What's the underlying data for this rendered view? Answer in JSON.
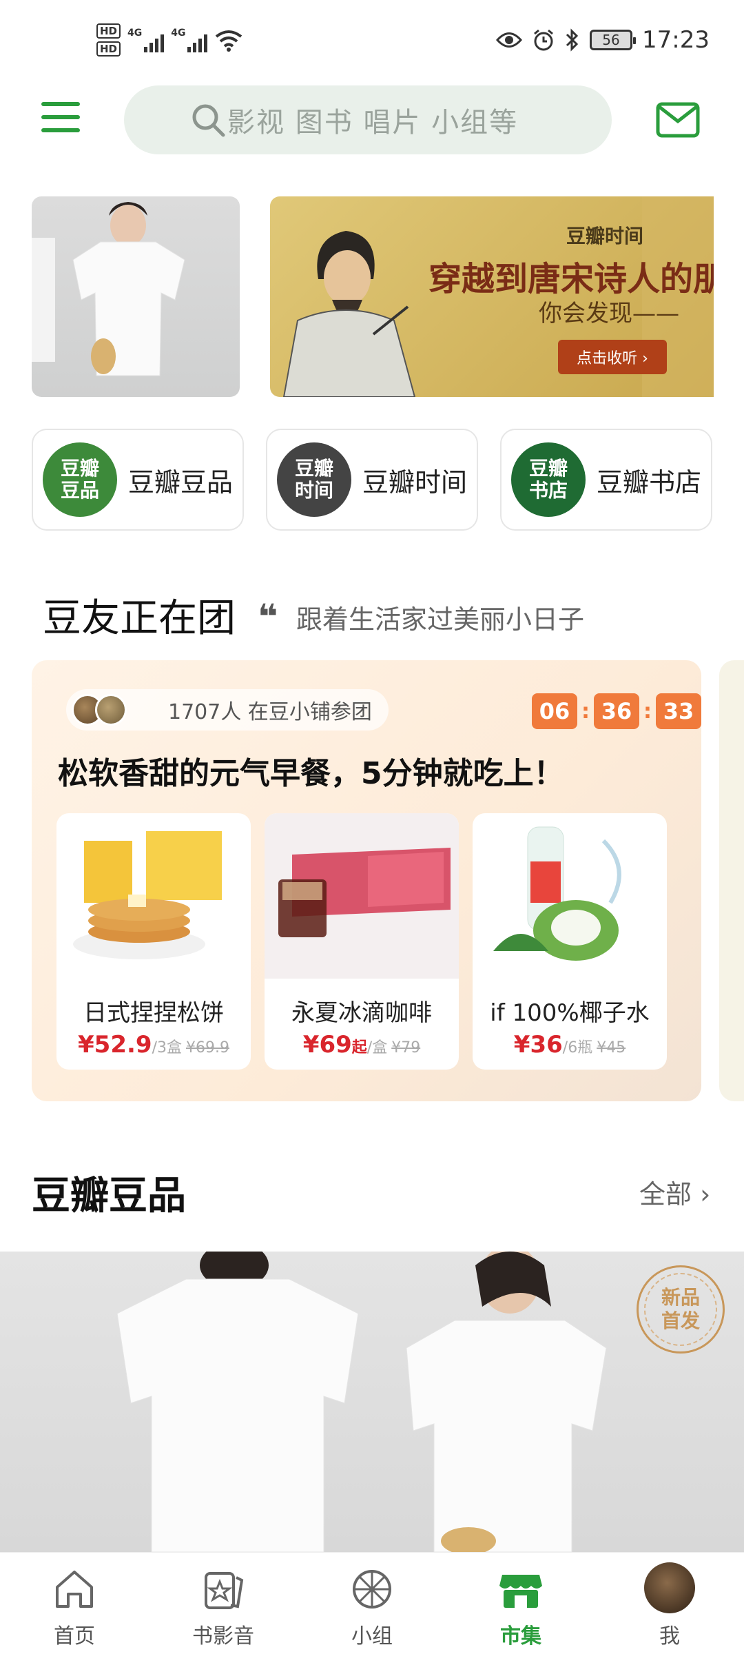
{
  "status_bar": {
    "hd1": "HD",
    "hd2": "HD",
    "net1": "4G",
    "net2": "4G",
    "battery": "56",
    "time": "17:23"
  },
  "header": {
    "search_placeholder": "影视 图书 唱片 小组等"
  },
  "banner": {
    "brand": "豆瓣时间",
    "title": "穿越到唐宋诗人的朋",
    "subtitle": "你会发现——",
    "button": "点击收听 ›"
  },
  "shortcuts": [
    {
      "logo": "豆瓣\n豆品",
      "label": "豆瓣豆品",
      "color": "#3d8a3a"
    },
    {
      "logo": "豆瓣\n时间",
      "label": "豆瓣时间",
      "color": "#444444"
    },
    {
      "logo": "豆瓣\n书店",
      "label": "豆瓣书店",
      "color": "#1f6b33"
    }
  ],
  "group_section": {
    "title": "豆友正在团",
    "quote": "❝",
    "subtitle": "跟着生活家过美丽小日子"
  },
  "group_card": {
    "participants": "1707人 在豆小铺参团",
    "timer": {
      "h": "06",
      "m": "36",
      "s": "33"
    },
    "headline": "松软香甜的元气早餐，5分钟就吃上！",
    "products": [
      {
        "name": "日式捏捏松饼",
        "price": "¥52.9",
        "price_suffix": "",
        "unit": "/3盒",
        "original": "¥69.9"
      },
      {
        "name": "永夏冰滴咖啡",
        "price": "¥69",
        "price_suffix": "起",
        "unit": "/盒",
        "original": "¥79"
      },
      {
        "name": "if 100%椰子水",
        "price": "¥36",
        "price_suffix": "",
        "unit": "/6瓶",
        "original": "¥45"
      }
    ]
  },
  "douban_products": {
    "title": "豆瓣豆品",
    "all": "全部 ›",
    "badge": "新品\n首发"
  },
  "tabbar": {
    "tabs": [
      {
        "label": "首页",
        "icon": "home-icon"
      },
      {
        "label": "书影音",
        "icon": "media-icon"
      },
      {
        "label": "小组",
        "icon": "group-icon"
      },
      {
        "label": "市集",
        "icon": "market-icon"
      },
      {
        "label": "我",
        "icon": "avatar"
      }
    ],
    "active": "市集"
  },
  "colors": {
    "accent": "#2a9d3c",
    "price": "#d9252c",
    "timer": "#f07a3b"
  }
}
